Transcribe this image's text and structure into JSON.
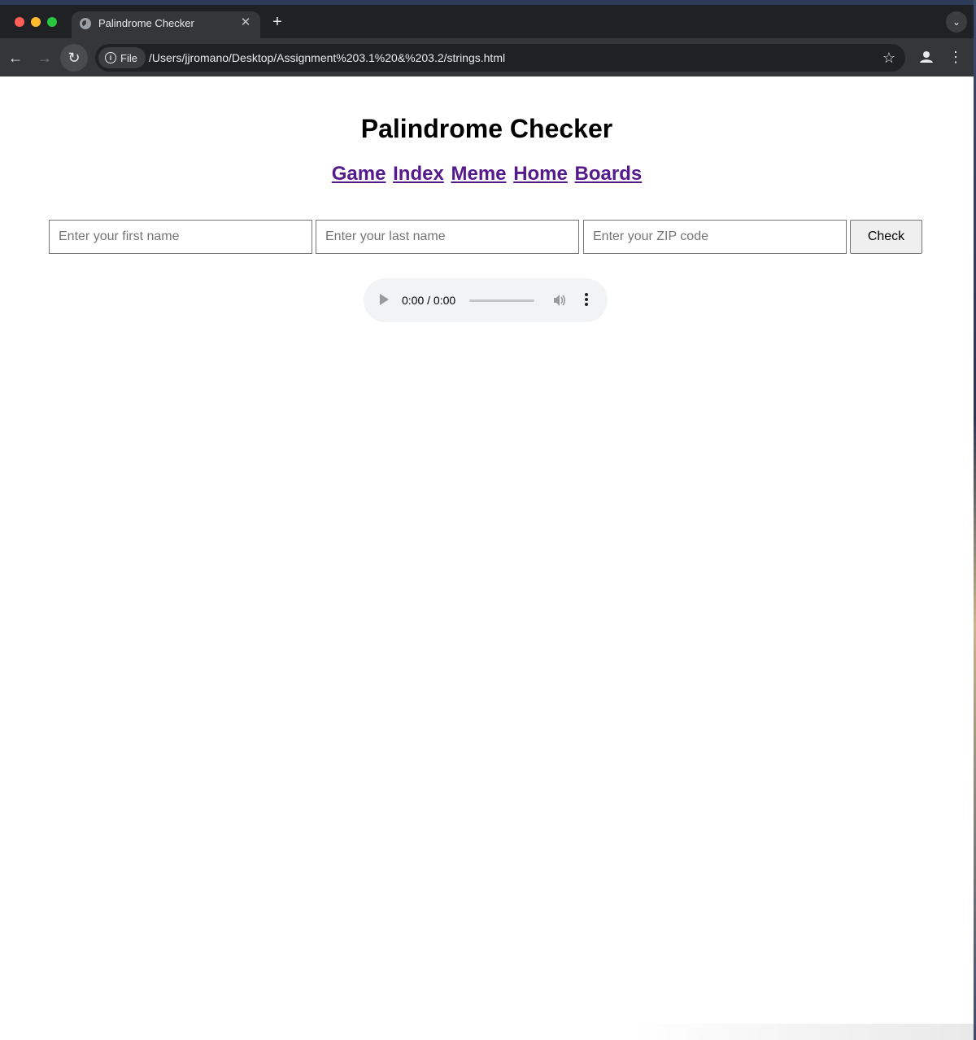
{
  "browser": {
    "tab_title": "Palindrome Checker",
    "tab_close": "✕",
    "new_tab": "+",
    "tab_search": "⌄",
    "chip_label": "File",
    "url": "/Users/jjromano/Desktop/Assignment%203.1%20&%203.2/strings.html",
    "back": "←",
    "forward": "→",
    "reload": "↻",
    "star": "☆",
    "menu": "⋮",
    "info": "i"
  },
  "page": {
    "title": "Palindrome Checker",
    "nav": [
      {
        "label": "Game"
      },
      {
        "label": "Index"
      },
      {
        "label": "Meme"
      },
      {
        "label": "Home"
      },
      {
        "label": "Boards"
      }
    ],
    "form": {
      "first_name_placeholder": "Enter your first name",
      "last_name_placeholder": "Enter your last name",
      "zip_placeholder": "Enter your ZIP code",
      "check_label": "Check"
    },
    "audio": {
      "time": "0:00 / 0:00"
    }
  }
}
